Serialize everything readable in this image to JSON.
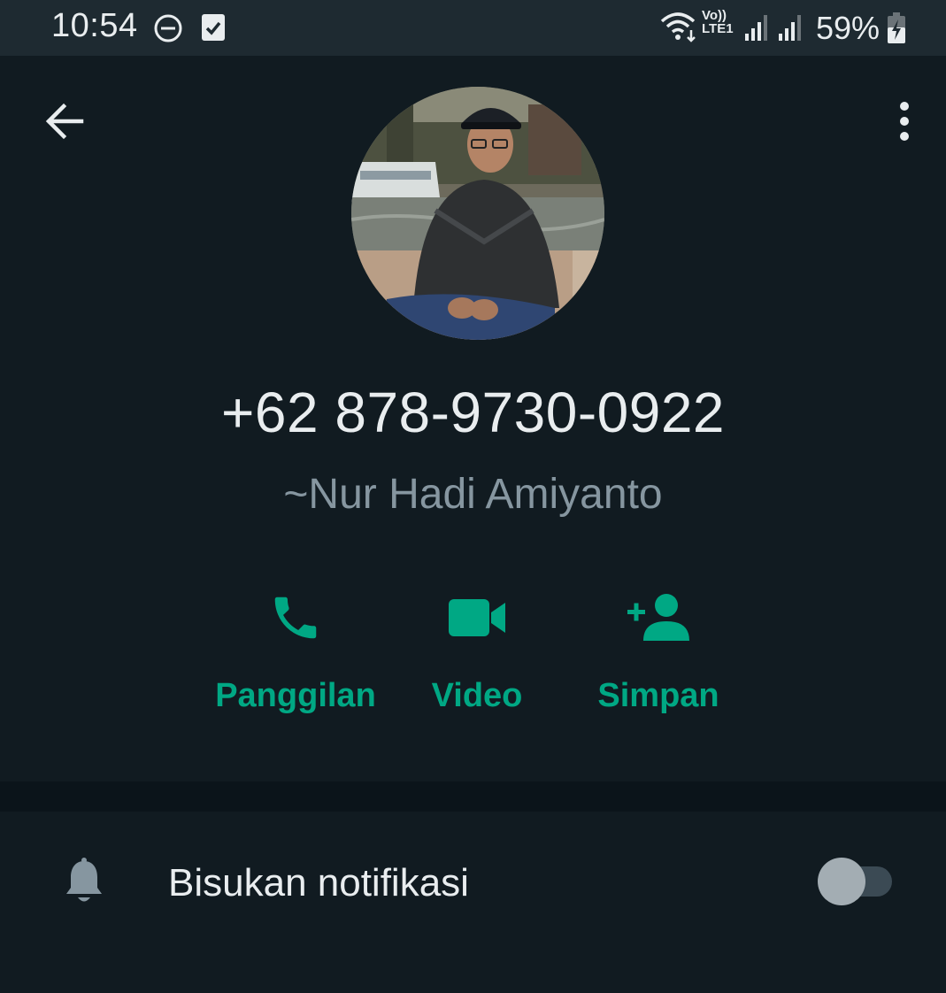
{
  "status_bar": {
    "time": "10:54",
    "battery_percent": "59%",
    "volte_top": "Vo))",
    "volte_bottom": "LTE1",
    "icons": [
      "dnd-icon",
      "checkbox-notification-icon",
      "wifi-icon",
      "signal-icon",
      "signal-icon",
      "battery-charging-icon"
    ]
  },
  "header": {
    "back_icon": "arrow-left-icon",
    "menu_icon": "more-vertical-icon"
  },
  "contact": {
    "phone": "+62 878-9730-0922",
    "pushname": "~Nur Hadi Amiyanto"
  },
  "actions": [
    {
      "label": "Panggilan",
      "icon": "phone-icon"
    },
    {
      "label": "Video",
      "icon": "video-camera-icon"
    },
    {
      "label": "Simpan",
      "icon": "add-person-icon"
    }
  ],
  "settings": {
    "mute_label": "Bisukan notifikasi",
    "mute_icon": "bell-icon",
    "mute_enabled": false
  },
  "colors": {
    "accent": "#00a884",
    "background": "#111b21",
    "status_bar": "#1e2a31",
    "divider": "#0b141a",
    "primary_text": "#e9edef",
    "secondary_text": "#8696a0"
  }
}
